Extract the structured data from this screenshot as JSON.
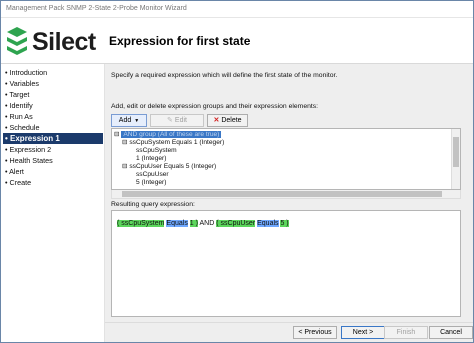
{
  "window": {
    "title": "Management Pack SNMP 2-State 2-Probe Monitor Wizard"
  },
  "banner": {
    "brand": "Silect",
    "page_title": "Expression for first state"
  },
  "nav": {
    "items": [
      {
        "label": "• Introduction"
      },
      {
        "label": "• Variables"
      },
      {
        "label": "• Target"
      },
      {
        "label": "• Identify"
      },
      {
        "label": "• Run As"
      },
      {
        "label": "• Schedule"
      },
      {
        "label": "• Expression 1"
      },
      {
        "label": "• Expression 2"
      },
      {
        "label": "• Health States"
      },
      {
        "label": "• Alert"
      },
      {
        "label": "• Create"
      }
    ],
    "active_index": 6
  },
  "main": {
    "description": "Specify a required expression which will define the first state of the monitor.",
    "groups_label": "Add, edit or delete expression groups and their expression elements:",
    "toolbar": {
      "add_label": "Add",
      "edit_label": "Edit",
      "delete_label": "Delete"
    },
    "tree": [
      {
        "text": "AND group (All of these are true)"
      },
      {
        "text": "ssCpuSystem   Equals   1 (Integer)"
      },
      {
        "text": "ssCpuSystem"
      },
      {
        "text": "1 (Integer)"
      },
      {
        "text": "ssCpuUser   Equals   5 (Integer)"
      },
      {
        "text": "ssCpuUser"
      },
      {
        "text": "5 (Integer)"
      }
    ],
    "result_label": "Resulting query expression:",
    "expression": {
      "t1": "( ssCpuSystem",
      "t2": "Equals",
      "t3": "1 )",
      "t4": "AND",
      "t5": "( ssCpuUser",
      "t6": "Equals",
      "t7": "5 )"
    }
  },
  "footer": {
    "previous": "< Previous",
    "next": "Next >",
    "finish": "Finish",
    "cancel": "Cancel"
  },
  "colors": {
    "nav_active": "#1b3a6b",
    "logo_green": "#2ea44f",
    "token_green": "#5cd65c",
    "token_blue": "#6fa8ff",
    "tree_selection": "#3a77c6"
  },
  "icons": {
    "logo": "silect-logo-icon",
    "delete": "red-x-icon",
    "edit": "pencil-icon",
    "dropdown": "chevron-down-icon"
  }
}
